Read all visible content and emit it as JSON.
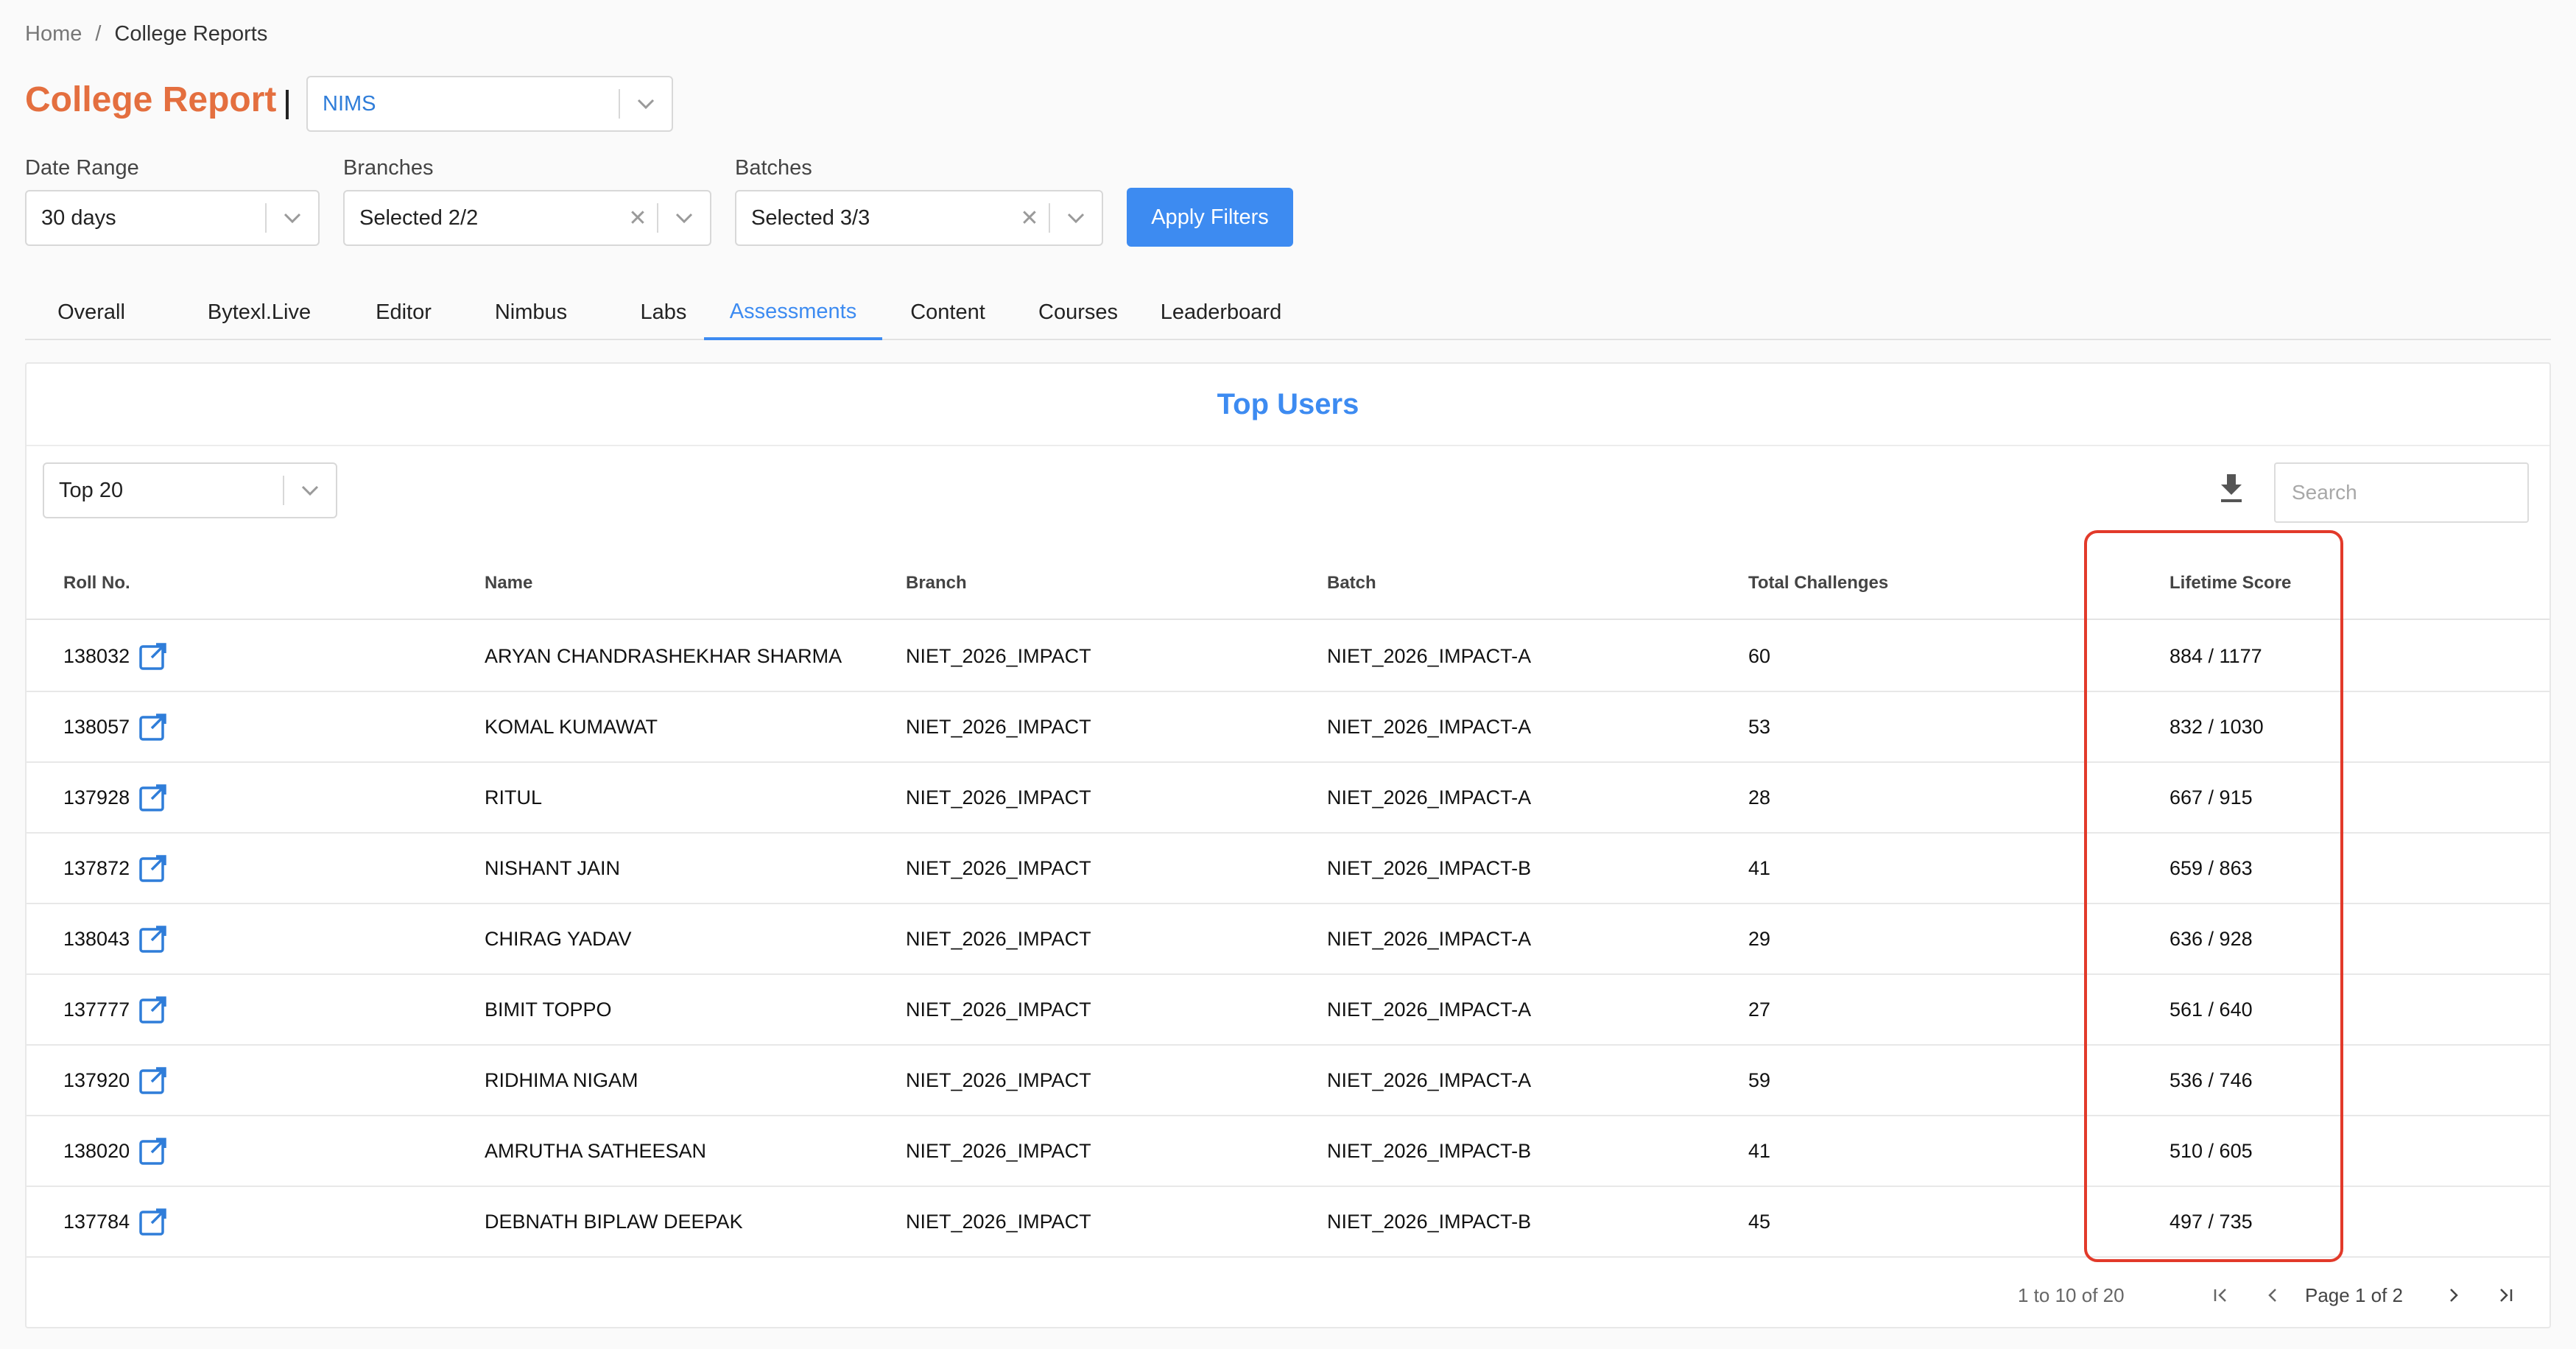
{
  "breadcrumb": {
    "home": "Home",
    "separator": "/",
    "current": "College Reports"
  },
  "header": {
    "title": "College Report",
    "college_select": "NIMS"
  },
  "filters": {
    "date_range_label": "Date Range",
    "date_range_value": "30 days",
    "branches_label": "Branches",
    "branches_value": "Selected 2/2",
    "batches_label": "Batches",
    "batches_value": "Selected 3/3",
    "apply_label": "Apply Filters"
  },
  "tabs": [
    "Overall",
    "Bytexl.Live",
    "Editor",
    "Nimbus",
    "Labs",
    "Assessments",
    "Content",
    "Courses",
    "Leaderboard"
  ],
  "active_tab": "Assessments",
  "card": {
    "title": "Top Users",
    "top_select": "Top 20",
    "search_placeholder": "Search"
  },
  "table": {
    "columns": [
      "Roll No.",
      "Name",
      "Branch",
      "Batch",
      "Total Challenges",
      "Lifetime Score"
    ],
    "rows": [
      {
        "roll": "138032",
        "name": "ARYAN CHANDRASHEKHAR SHARMA",
        "branch": "NIET_2026_IMPACT",
        "batch": "NIET_2026_IMPACT-A",
        "challenges": "60",
        "score": "884 / 1177"
      },
      {
        "roll": "138057",
        "name": "KOMAL KUMAWAT",
        "branch": "NIET_2026_IMPACT",
        "batch": "NIET_2026_IMPACT-A",
        "challenges": "53",
        "score": "832 / 1030"
      },
      {
        "roll": "137928",
        "name": "RITUL",
        "branch": "NIET_2026_IMPACT",
        "batch": "NIET_2026_IMPACT-A",
        "challenges": "28",
        "score": "667 / 915"
      },
      {
        "roll": "137872",
        "name": "NISHANT JAIN",
        "branch": "NIET_2026_IMPACT",
        "batch": "NIET_2026_IMPACT-B",
        "challenges": "41",
        "score": "659 / 863"
      },
      {
        "roll": "138043",
        "name": "CHIRAG YADAV",
        "branch": "NIET_2026_IMPACT",
        "batch": "NIET_2026_IMPACT-A",
        "challenges": "29",
        "score": "636 / 928"
      },
      {
        "roll": "137777",
        "name": "BIMIT TOPPO",
        "branch": "NIET_2026_IMPACT",
        "batch": "NIET_2026_IMPACT-A",
        "challenges": "27",
        "score": "561 / 640"
      },
      {
        "roll": "137920",
        "name": "RIDHIMA NIGAM",
        "branch": "NIET_2026_IMPACT",
        "batch": "NIET_2026_IMPACT-A",
        "challenges": "59",
        "score": "536 / 746"
      },
      {
        "roll": "138020",
        "name": "AMRUTHA SATHEESAN",
        "branch": "NIET_2026_IMPACT",
        "batch": "NIET_2026_IMPACT-B",
        "challenges": "41",
        "score": "510 / 605"
      },
      {
        "roll": "137784",
        "name": "DEBNATH BIPLAW DEEPAK",
        "branch": "NIET_2026_IMPACT",
        "batch": "NIET_2026_IMPACT-B",
        "challenges": "45",
        "score": "497 / 735"
      }
    ]
  },
  "pagination": {
    "range_text": "1 to 10 of 20",
    "page_text": "Page 1 of 2"
  },
  "colors": {
    "accent": "#3d8bf1",
    "title_orange": "#e46f3f",
    "highlight_red": "#e23a2a"
  }
}
